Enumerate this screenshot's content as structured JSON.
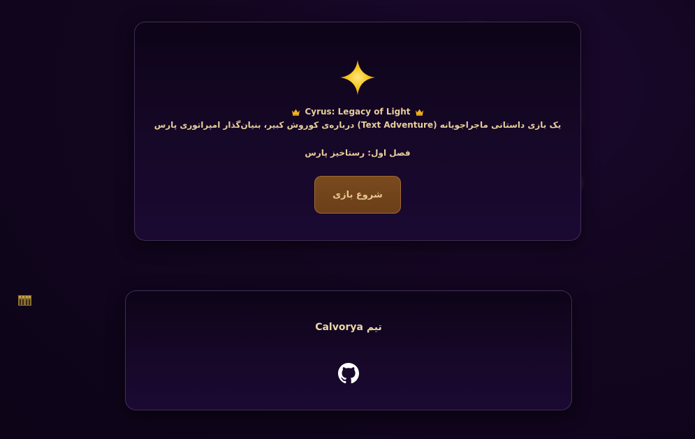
{
  "game": {
    "title": "Cyrus: Legacy of Light",
    "subtitle": "یک بازی داستانی ماجراجویانه (Text Adventure) درباره‌ی کوروش کبیر، بنیان‌گذار امپراتوری پارس",
    "chapter": "فصل اول: رستاخیز پارس",
    "start_button_label": "شروع بازی",
    "icons": {
      "hero": "sparkle-star-icon",
      "title_decoration": "crown-icon"
    }
  },
  "footer": {
    "team_label": "تیم Calvorya",
    "github_icon": "github-icon"
  },
  "side": {
    "icon": "castle-icon"
  },
  "colors": {
    "background": "#12061f",
    "card_border": "#5a4a70",
    "accent_gold": "#e6cf9a",
    "button_bg": "#7a4a1e",
    "star_gold": "#f5c518"
  }
}
